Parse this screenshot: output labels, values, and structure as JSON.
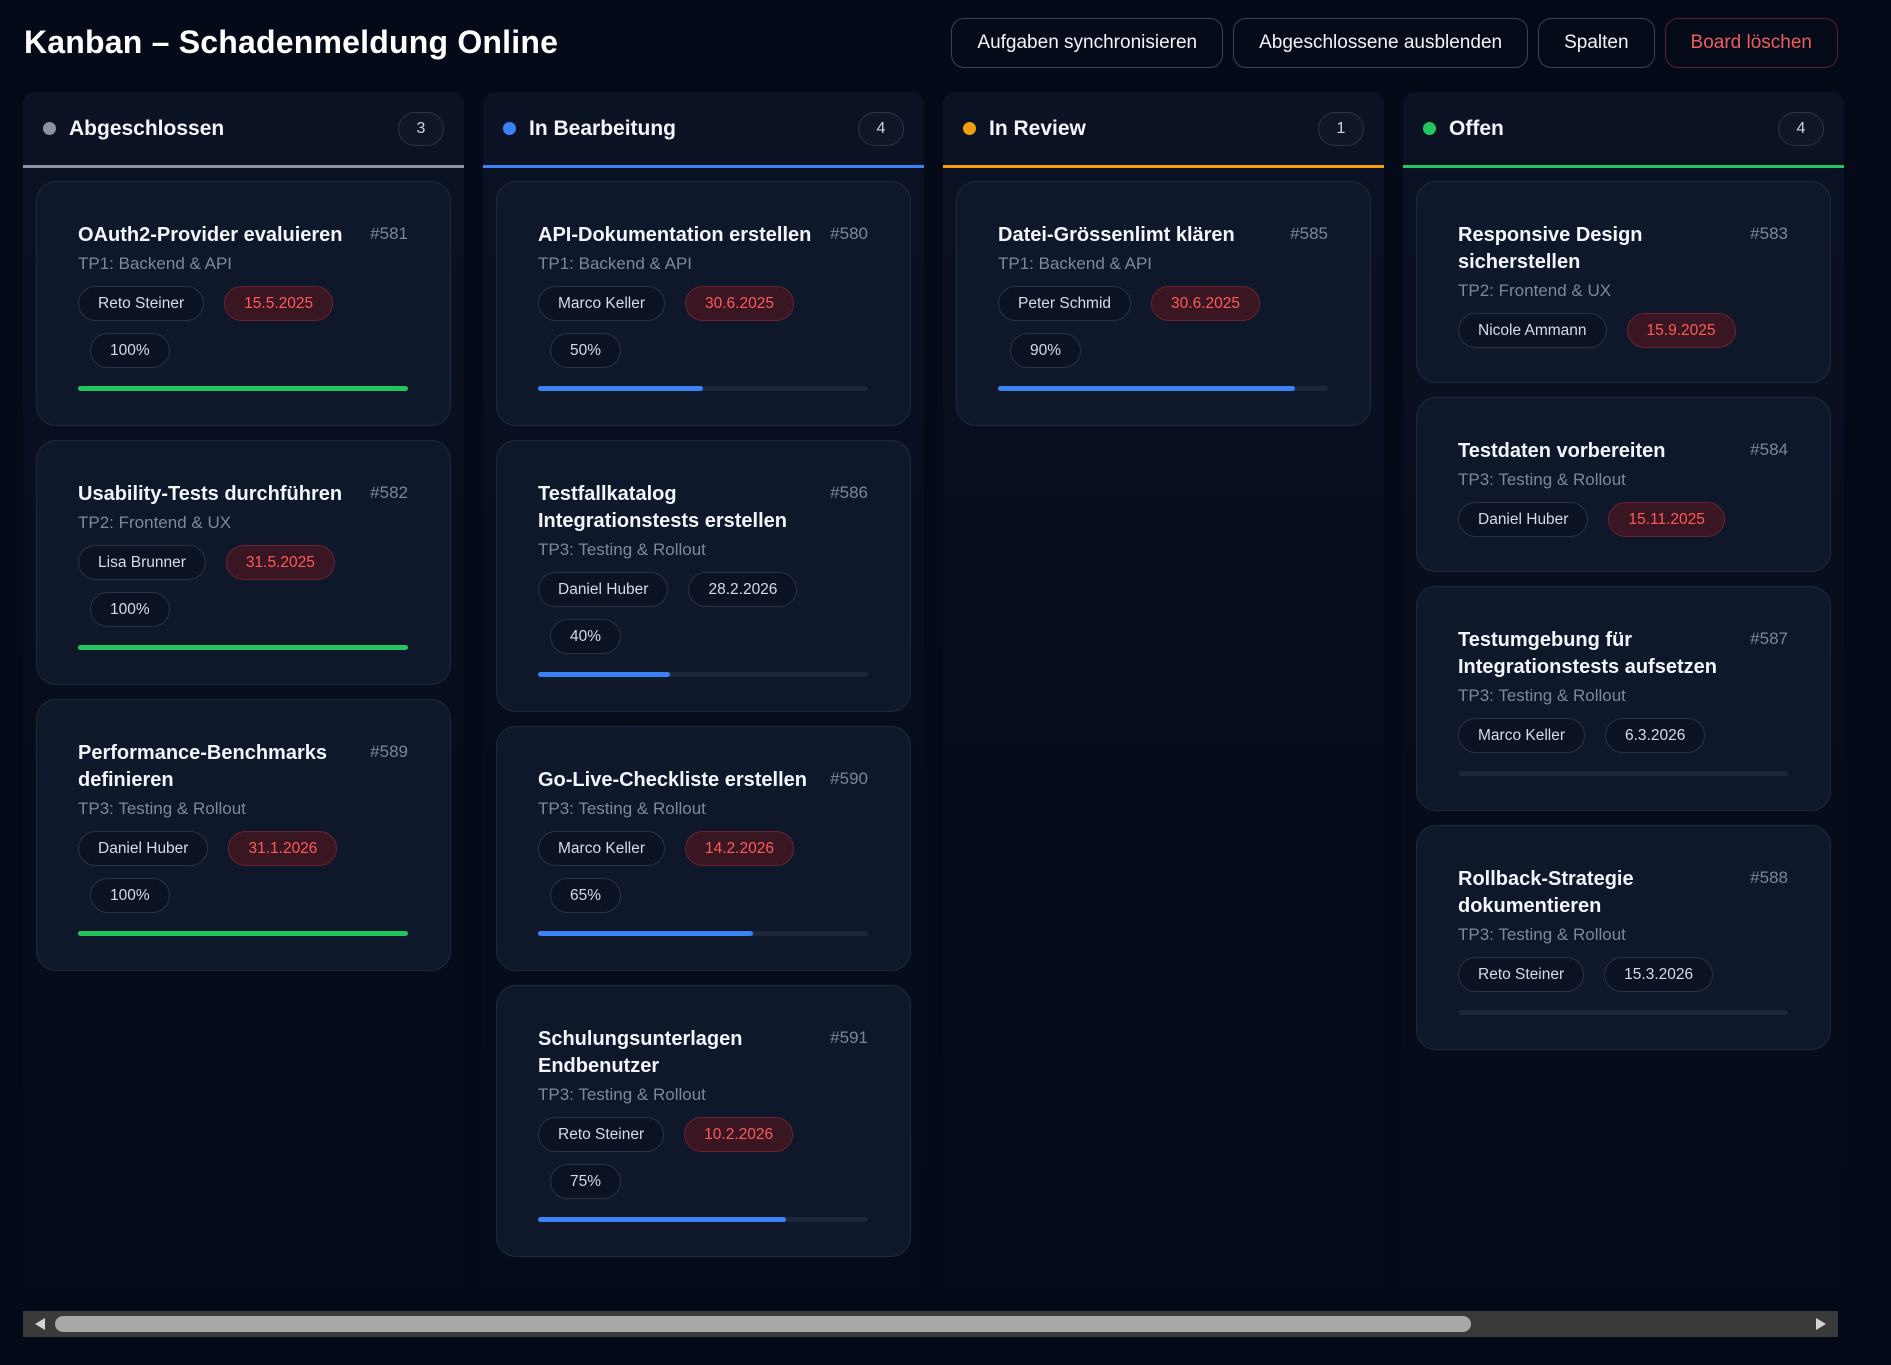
{
  "title": "Kanban – Schadenmeldung Online",
  "actions": {
    "sync": "Aufgaben synchronisieren",
    "hide_done": "Abgeschlossene ausblenden",
    "columns": "Spalten",
    "delete_board": "Board löschen"
  },
  "colors": {
    "done": "#22c55e",
    "in_progress": "#3b82f6",
    "review": "#f59e0b",
    "open": "#22c55e",
    "done_dot": "#94a3b8",
    "overdue": "#ff5a5a"
  },
  "columns": [
    {
      "key": "done",
      "title": "Abgeschlossen",
      "count": "3",
      "dot": "#8b93a5",
      "line": "#8b93a5",
      "cards": [
        {
          "title": "OAuth2-Provider evaluieren",
          "id": "#581",
          "sub": "TP1: Backend & API",
          "person": "Reto Steiner",
          "date": "15.5.2025",
          "overdue": true,
          "pct": "100%",
          "progress": 1.0,
          "bar": "#22c55e"
        },
        {
          "title": "Usability-Tests durchführen",
          "id": "#582",
          "sub": "TP2: Frontend & UX",
          "person": "Lisa Brunner",
          "date": "31.5.2025",
          "overdue": true,
          "pct": "100%",
          "progress": 1.0,
          "bar": "#22c55e"
        },
        {
          "title": "Performance-Benchmarks definieren",
          "id": "#589",
          "sub": "TP3: Testing & Rollout",
          "person": "Daniel Huber",
          "date": "31.1.2026",
          "overdue": true,
          "pct": "100%",
          "progress": 1.0,
          "bar": "#22c55e"
        }
      ]
    },
    {
      "key": "in_progress",
      "title": "In Bearbeitung",
      "count": "4",
      "dot": "#3b82f6",
      "line": "#3b82f6",
      "cards": [
        {
          "title": "API-Dokumentation erstellen",
          "id": "#580",
          "sub": "TP1: Backend & API",
          "person": "Marco Keller",
          "date": "30.6.2025",
          "overdue": true,
          "pct": "50%",
          "progress": 0.5,
          "bar": "#3b82f6"
        },
        {
          "title": "Testfallkatalog Integrationstests erstellen",
          "id": "#586",
          "sub": "TP3: Testing & Rollout",
          "person": "Daniel Huber",
          "date": "28.2.2026",
          "overdue": false,
          "pct": "40%",
          "progress": 0.4,
          "bar": "#3b82f6"
        },
        {
          "title": "Go-Live-Checkliste erstellen",
          "id": "#590",
          "sub": "TP3: Testing & Rollout",
          "person": "Marco Keller",
          "date": "14.2.2026",
          "overdue": true,
          "pct": "65%",
          "progress": 0.65,
          "bar": "#3b82f6"
        },
        {
          "title": "Schulungsunterlagen Endbenutzer",
          "id": "#591",
          "sub": "TP3: Testing & Rollout",
          "person": "Reto Steiner",
          "date": "10.2.2026",
          "overdue": true,
          "pct": "75%",
          "progress": 0.75,
          "bar": "#3b82f6"
        }
      ]
    },
    {
      "key": "review",
      "title": "In Review",
      "count": "1",
      "dot": "#f59e0b",
      "line": "#f59e0b",
      "cards": [
        {
          "title": "Datei-Grössenlimt klären",
          "id": "#585",
          "sub": "TP1: Backend & API",
          "person": "Peter Schmid",
          "date": "30.6.2025",
          "overdue": true,
          "pct": "90%",
          "progress": 0.9,
          "bar": "#3b82f6"
        }
      ]
    },
    {
      "key": "open",
      "title": "Offen",
      "count": "4",
      "dot": "#22c55e",
      "line": "#22c55e",
      "cards": [
        {
          "title": "Responsive Design sicherstellen",
          "id": "#583",
          "sub": "TP2: Frontend & UX",
          "person": "Nicole Ammann",
          "date": "15.9.2025",
          "overdue": true,
          "pct": "",
          "progress": null,
          "bar": ""
        },
        {
          "title": "Testdaten vorbereiten",
          "id": "#584",
          "sub": "TP3: Testing & Rollout",
          "person": "Daniel Huber",
          "date": "15.11.2025",
          "overdue": true,
          "pct": "",
          "progress": null,
          "bar": ""
        },
        {
          "title": "Testumgebung für Integrationstests aufsetzen",
          "id": "#587",
          "sub": "TP3: Testing & Rollout",
          "person": "Marco Keller",
          "date": "6.3.2026",
          "overdue": false,
          "pct": "",
          "progress": 0,
          "bar": "#3b82f6"
        },
        {
          "title": "Rollback-Strategie dokumentieren",
          "id": "#588",
          "sub": "TP3: Testing & Rollout",
          "person": "Reto Steiner",
          "date": "15.3.2026",
          "overdue": false,
          "pct": "",
          "progress": 0,
          "bar": "#3b82f6"
        }
      ]
    }
  ],
  "scrollbar": {
    "position": 0.0,
    "visible_fraction": 0.8
  }
}
